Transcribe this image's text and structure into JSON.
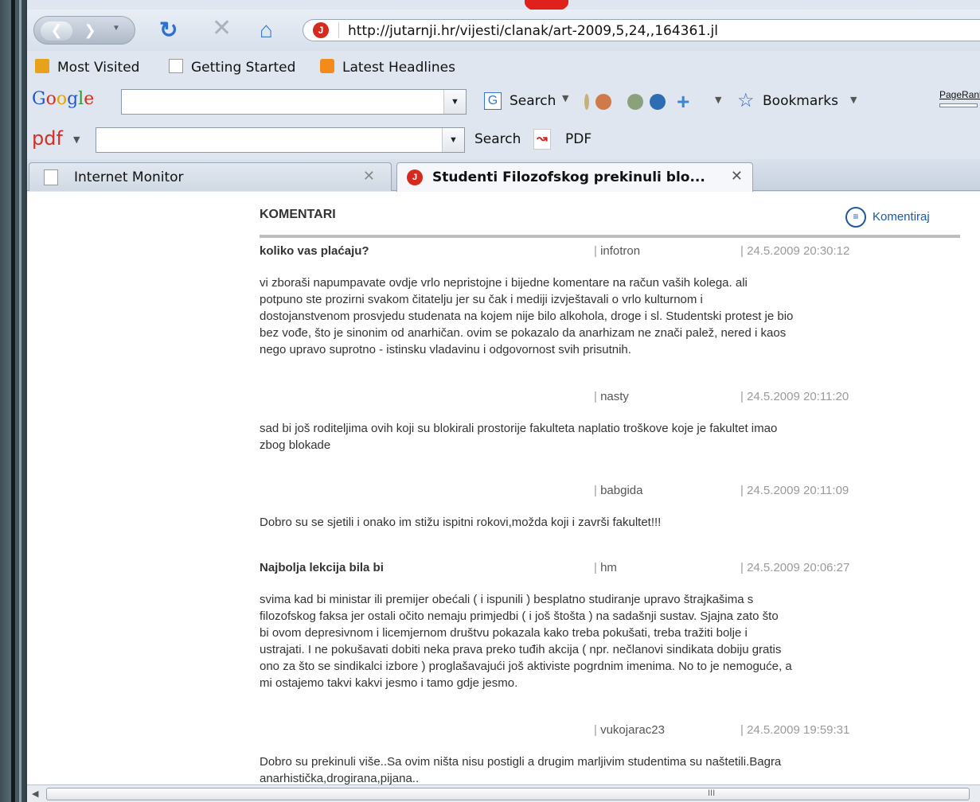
{
  "browser": {
    "url": "http://jutarnji.hr/vijesti/clanak/art-2009,5,24,,164361.jl",
    "site_icon_letter": "J"
  },
  "bookmarks": [
    "Most Visited",
    "Getting Started",
    "Latest Headlines"
  ],
  "google_toolbar": {
    "logo": [
      "G",
      "o",
      "o",
      "g",
      "l",
      "e"
    ],
    "search_label": "Search",
    "bookmarks_label": "Bookmarks",
    "pagerank_label": "PageRank"
  },
  "pdf_toolbar": {
    "logo": "pdf",
    "search_label": "Search",
    "pdf_label": "PDF"
  },
  "tabs": [
    {
      "title": "Internet Monitor",
      "active": false
    },
    {
      "title": "Studenti Filozofskog prekinuli blo...",
      "active": true
    }
  ],
  "page": {
    "header": "KOMENTARI",
    "comment_link": "Komentiraj",
    "separator": "|",
    "comments": [
      {
        "title": "koliko vas plaćaju?",
        "author": "infotron",
        "date": "24.5.2009 20:30:12",
        "lines": [
          "vi zboraši napumpavate ovdje vrlo nepristojne i bijedne komentare na račun vaših kolega. ali",
          "potpuno ste prozirni svakom čitatelju jer su čak i mediji izvještavali o vrlo kulturnom i",
          "dostojanstvenom prosvjedu studenata na kojem nije bilo alkohola, droge i sl. Studentski protest je bio",
          "bez vođe, što je sinonim od anarhičan. ovim se pokazalo da anarhizam ne znači palež, nered i kaos",
          "nego upravo suprotno - istinsku vladavinu i odgovornost svih prisutnih."
        ]
      },
      {
        "title": "",
        "author": "nasty",
        "date": "24.5.2009 20:11:20",
        "lines": [
          "sad bi još roditeljima ovih koji su blokirali prostorije fakulteta naplatio troškove koje je fakultet imao",
          "zbog blokade"
        ]
      },
      {
        "title": "",
        "author": "babgida",
        "date": "24.5.2009 20:11:09",
        "lines": [
          "Dobro su se sjetili i onako im stižu ispitni rokovi,možda koji i završi fakultet!!!"
        ]
      },
      {
        "title": "Najbolja lekcija bila bi",
        "author": "hm",
        "date": "24.5.2009 20:06:27",
        "lines": [
          "svima kad bi ministar ili premijer obećali ( i ispunili ) besplatno studiranje upravo štrajkašima s",
          "filozofskog faksa jer ostali očito nemaju primjedbi ( i još štošta ) na sadašnji sustav. Sjajna zato što",
          "bi ovom depresivnom i licemjernom društvu pokazala kako treba pokušati, treba tražiti bolje i",
          "ustrajati. I ne pokušavati dobiti neka prava preko tuđih akcija ( npr. nečlanovi sindikata dobiju gratis",
          "ono za što se sindikalci izbore ) proglašavajući još aktiviste pogrdnim imenima. No to je nemoguće, a",
          "mi ostajemo takvi kakvi jesmo i tamo gdje jesmo."
        ]
      },
      {
        "title": "",
        "author": "vukojarac23",
        "date": "24.5.2009 19:59:31",
        "lines": [
          "Dobro su prekinuli više..Sa ovim ništa nisu postigli a drugim marljivim studentima su naštetili.Bagra",
          "anarhistička,drogirana,pijana.."
        ]
      }
    ]
  },
  "scrollbar": {
    "grip": "III"
  }
}
